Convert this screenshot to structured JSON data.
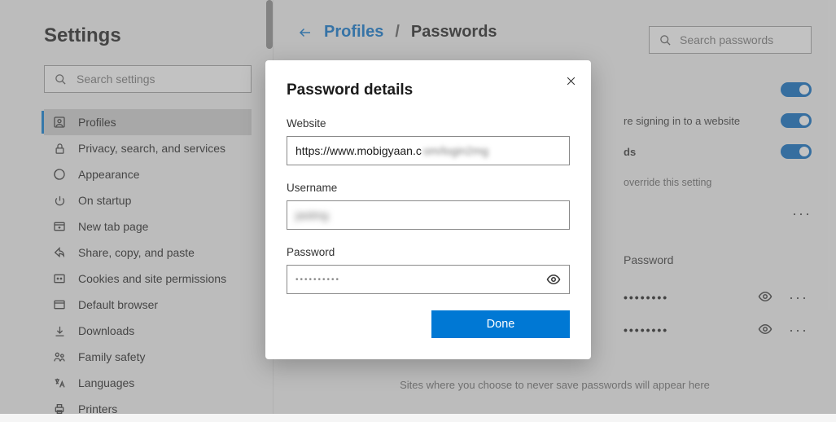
{
  "sidebar": {
    "title": "Settings",
    "search_placeholder": "Search settings",
    "items": [
      {
        "label": "Profiles"
      },
      {
        "label": "Privacy, search, and services"
      },
      {
        "label": "Appearance"
      },
      {
        "label": "On startup"
      },
      {
        "label": "New tab page"
      },
      {
        "label": "Share, copy, and paste"
      },
      {
        "label": "Cookies and site permissions"
      },
      {
        "label": "Default browser"
      },
      {
        "label": "Downloads"
      },
      {
        "label": "Family safety"
      },
      {
        "label": "Languages"
      },
      {
        "label": "Printers"
      }
    ]
  },
  "header": {
    "crumb_link": "Profiles",
    "crumb_sep": "/",
    "crumb_current": "Passwords",
    "search_placeholder": "Search passwords"
  },
  "settings_rows": {
    "row1_tail": "re signing in to a website",
    "row2_tail_a": "ds",
    "row2_tail_b": "override this setting"
  },
  "passwords": {
    "col_header": "Password",
    "mask": "••••••••"
  },
  "footer": "Sites where you choose to never save passwords will appear here",
  "dialog": {
    "title": "Password details",
    "website_label": "Website",
    "website_value": "https://www.mobigyaan.c",
    "website_blur_tail": "om/login2mg",
    "username_label": "Username",
    "username_blur": "jasting",
    "password_label": "Password",
    "password_mask": "••••••••••",
    "done": "Done"
  }
}
